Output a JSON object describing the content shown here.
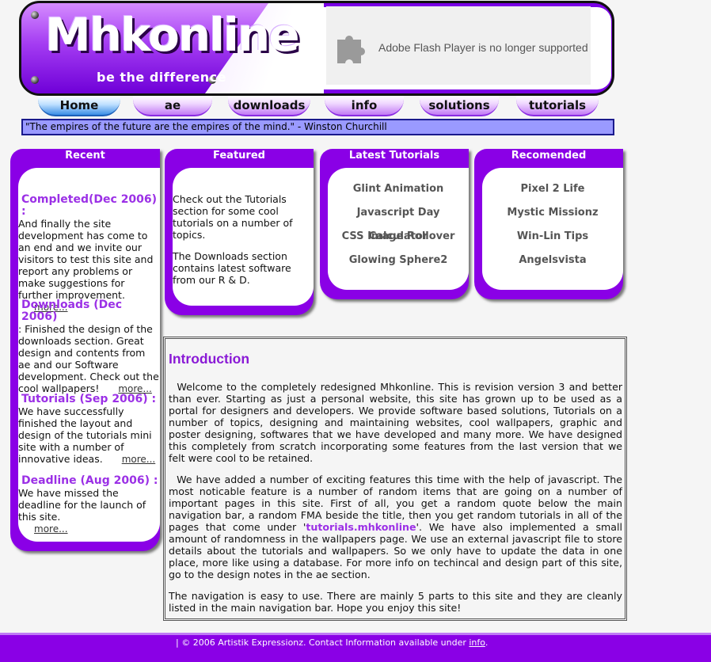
{
  "header": {
    "logo": "Mhkonline",
    "tagline": "be the difference",
    "flash_message": "Adobe Flash Player is no longer supported"
  },
  "nav": {
    "tabs": [
      "Home",
      "ae",
      "downloads",
      "info",
      "solutions",
      "tutorials"
    ],
    "active": "Home"
  },
  "quote": "\"The empires of the future are the empires of the mind.\" - Winston Churchill",
  "recent": {
    "title": "Recent",
    "items": [
      {
        "heading": "Completed(Dec 2006) :",
        "text": "And finally the site development has come to an end and we invite our visitors to test this site and report any problems or make suggestions for further improvement.",
        "more": "more..."
      },
      {
        "heading": "Downloads (Dec 2006)",
        "text": ": Finished the design of the downloads section. Great design and contents from ae and our Software development. Check out the cool wallpapers!",
        "more": "more..."
      },
      {
        "heading": "Tutorials (Sep 2006) :",
        "text": "We have successfully finished the layout and design of the tutorials mini site with a number of innovative ideas.",
        "more": "more..."
      },
      {
        "heading": "Deadline (Aug 2006) :",
        "text": "We have missed the deadline for the launch of this site.",
        "more": "more..."
      }
    ]
  },
  "featured": {
    "title": "Featured",
    "p1": "Check out the Tutorials section for some cool tutorials on a number of topics.",
    "p2": "The Downloads section contains latest software from our R & D."
  },
  "latest": {
    "title": "Latest Tutorials",
    "items": [
      "Glint Animation",
      "Javascript Day Calculator",
      "CSS Image Rollover",
      "Glowing Sphere2"
    ]
  },
  "recommended": {
    "title": "Recomended",
    "items": [
      "Pixel 2 Life",
      "Mystic Missionz",
      "Win-Lin Tips",
      "Angelsvista"
    ]
  },
  "intro": {
    "title": "Introduction",
    "p1": "Welcome to the completely redesigned Mhkonline. This is revision version 3 and better than ever. Starting as just a personal website, this site has grown up to be used as a portal for designers and developers. We provide software based solutions, Tutorials on a number of topics, designing and maintaining websites, cool wallpapers, graphic and poster designing, softwares that we have developed and many more. We have designed this completely from scratch incorporating some features from the last version that we felt were cool to be retained.",
    "p2_a": "We have added a number of exciting features this time with the help of javascript. The most noticable feature is a number of random items that are going on a number of important pages in this site. First of all, you get a random quote below the main navigation bar, a random FMA beside the title, then you get random tutorials in all of the pages that come under '",
    "p2_link": "tutorials.mhkonline",
    "p2_b": "'. We have also implemented a small amount of randomness in the wallpapers page. We use an external javascript file to store details about the tutorials and wallpapers. So we only have to update the data in one place, more like using a database. For more info on techincal and design part of this site, go to the design notes in the ae section.",
    "p3": "The navigation is easy to use. There are mainly 5 parts to this site and they are cleanly listed in the main navigation bar. Hope you enjoy this site!"
  },
  "footer": {
    "text": "| © 2006 Artistik Expressionz. Contact Information available under ",
    "link": "info",
    "end": "."
  }
}
